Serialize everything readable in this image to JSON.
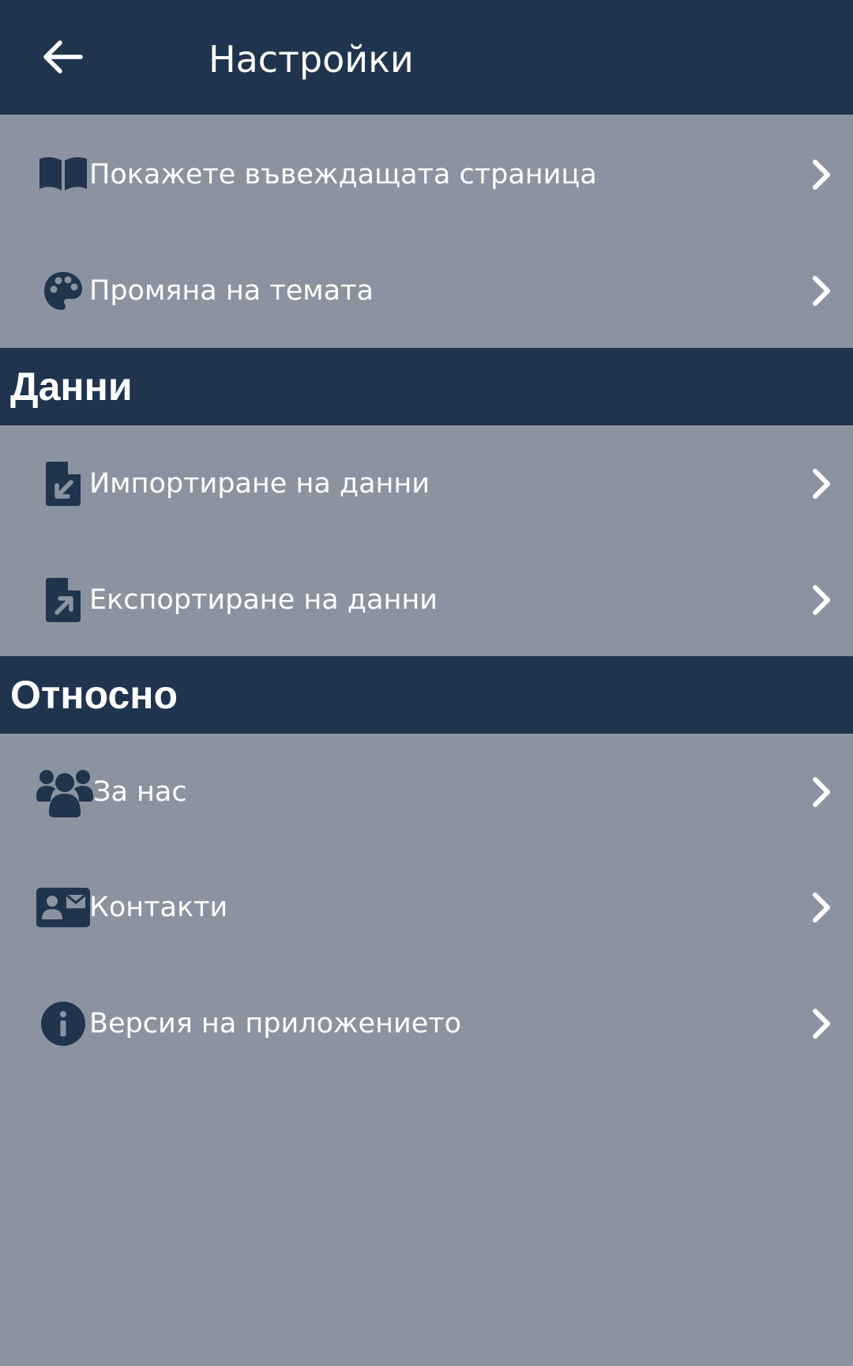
{
  "header": {
    "title": "Настройки",
    "back_icon": "arrow-left-icon"
  },
  "general": {
    "items": [
      {
        "label": "Покажете въвеждащата страница",
        "icon": "book-open-icon"
      },
      {
        "label": "Промяна на темата",
        "icon": "palette-icon"
      }
    ]
  },
  "data_section": {
    "title": "Данни",
    "items": [
      {
        "label": "Импортиране на данни",
        "icon": "file-import-icon"
      },
      {
        "label": "Експортиране на данни",
        "icon": "file-export-icon"
      }
    ]
  },
  "about_section": {
    "title": "Относно",
    "items": [
      {
        "label": "За нас",
        "icon": "users-icon"
      },
      {
        "label": "Контакти",
        "icon": "contact-card-icon"
      },
      {
        "label": "Версия на приложението",
        "icon": "info-circle-icon"
      }
    ]
  },
  "colors": {
    "primary": "#21344e",
    "background": "#8c93a0",
    "text": "#ffffff"
  }
}
